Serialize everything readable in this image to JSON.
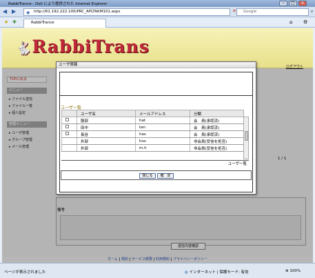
{
  "browser": {
    "title": "RabbiTrance - Dell により提供された Internet Explorer",
    "url": "http://61.192.222.100/PRC_APLTAKM101.aspx",
    "search_placeholder": "Google",
    "tab_label": "RabbiTrance"
  },
  "header": {
    "logo": "RabbiTrans",
    "logout": "ログアウト"
  },
  "sidebar": {
    "top_link": "TOPに戻る",
    "menu_header": "メニュー",
    "items": [
      "ファイル送信",
      "ファイル一覧",
      "個人設定"
    ],
    "admin_header": "管理メニュー",
    "admin_items": [
      "ユーザ管理",
      "グループ管理",
      "メール管理"
    ]
  },
  "main": {
    "remarks_label": "備考",
    "send_button": "送信内容確認",
    "pager": "1 / 1"
  },
  "dialog": {
    "title": "ユーザ情報",
    "list_label": "ユーザ一覧",
    "columns": [
      "ユーザ名",
      "メールアドレス",
      "分類"
    ],
    "rows": [
      {
        "name": "服部",
        "email": "hat",
        "type": "会　員(承認済)",
        "checkbox": true
      },
      {
        "name": "田中",
        "email": "tan",
        "type": "会　員(承認済)",
        "checkbox": true
      },
      {
        "name": "長谷",
        "email": "has",
        "type": "会　員(承認済)",
        "checkbox": true
      },
      {
        "name": "外部",
        "email": "hos",
        "type": "非会員(受信を拒否)",
        "checkbox": false
      },
      {
        "name": "外部",
        "email": "m.h",
        "type": "非会員(受信を拒否)",
        "checkbox": false
      }
    ],
    "grid_footer": "ユーザ一覧",
    "close_button": "閉じる",
    "ok_button": "確　定"
  },
  "footer": {
    "links": [
      "ホーム",
      "|",
      "規約",
      "|",
      "サービス概要",
      "|",
      "利用規約",
      "|",
      "プライバシーポリシー"
    ]
  },
  "status": {
    "left": "ページが表示されました",
    "zone": "インターネット | 保護モード: 有効",
    "zoom": "100%"
  }
}
